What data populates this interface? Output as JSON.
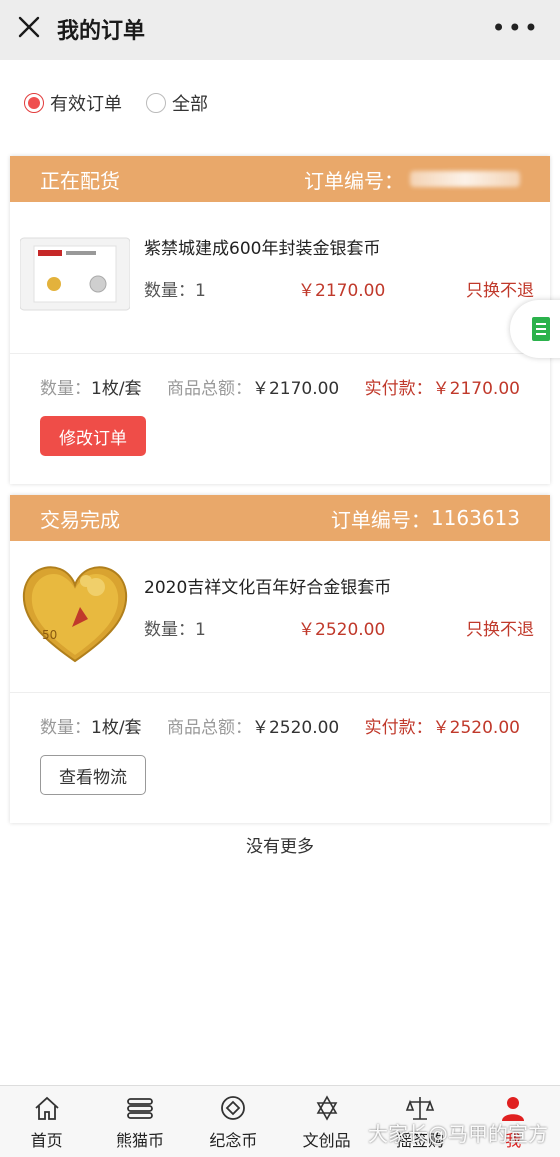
{
  "header": {
    "title": "我的订单",
    "more": "•••"
  },
  "filter": {
    "options": [
      {
        "label": "有效订单",
        "selected": true
      },
      {
        "label": "全部",
        "selected": false
      }
    ]
  },
  "orders": [
    {
      "status": "正在配货",
      "order_label": "订单编号：",
      "order_number": "",
      "product_name": "紫禁城建成600年封装金银套币",
      "qty_label": "数量：1",
      "price": "￥2170.00",
      "policy": "只换不退",
      "summary_qty_label": "数量：",
      "summary_qty": "1枚/套",
      "total_label": "商品总额：",
      "total": "￥2170.00",
      "paid_label": "实付款：",
      "paid": "￥2170.00",
      "action": "修改订单"
    },
    {
      "status": "交易完成",
      "order_label": "订单编号：",
      "order_number": "1163613",
      "product_name": "2020吉祥文化百年好合金银套币",
      "qty_label": "数量：1",
      "price": "￥2520.00",
      "policy": "只换不退",
      "summary_qty_label": "数量：",
      "summary_qty": "1枚/套",
      "total_label": "商品总额：",
      "total": "￥2520.00",
      "paid_label": "实付款：",
      "paid": "￥2520.00",
      "action": "查看物流"
    }
  ],
  "footer_text": "没有更多",
  "tabbar": [
    {
      "label": "首页",
      "icon": "home-icon"
    },
    {
      "label": "熊猫币",
      "icon": "coin-stack-icon"
    },
    {
      "label": "纪念币",
      "icon": "diamond-coin-icon"
    },
    {
      "label": "文创品",
      "icon": "star-icon"
    },
    {
      "label": "摇签购",
      "icon": "scale-icon"
    },
    {
      "label": "我",
      "icon": "user-icon"
    }
  ],
  "watermark": "大家长@马甲的宣方",
  "colors": {
    "accent": "#e9a86a",
    "price": "#c0392b",
    "primary_button": "#ef4d48"
  }
}
